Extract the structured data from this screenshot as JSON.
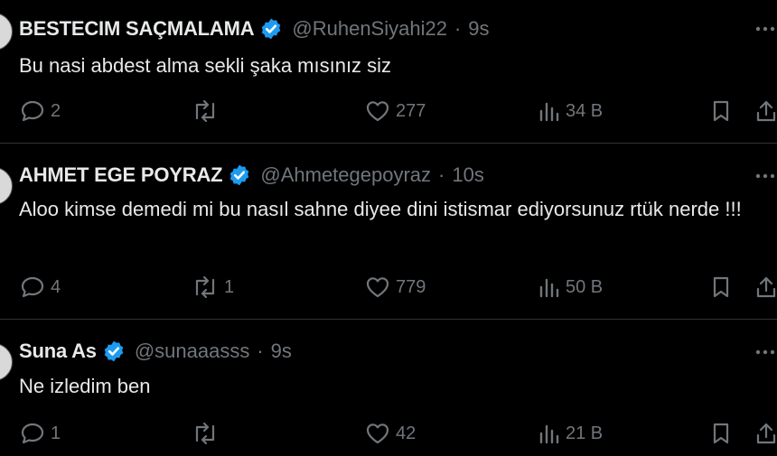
{
  "tweets": [
    {
      "name": "BESTECIM SAÇMALAMA",
      "handle": "@RuhenSiyahi22",
      "time": "9s",
      "text": "Bu nasi abdest alma sekli  şaka mısınız siz",
      "replies": "2",
      "retweets": "",
      "likes": "277",
      "views": "34 B"
    },
    {
      "name": "AHMET EGE POYRAZ",
      "handle": "@Ahmetegepoyraz",
      "time": "10s",
      "text": "Aloo kimse demedi mi bu nasıl sahne diyee  dini istismar ediyorsunuz rtük nerde !!!",
      "replies": "4",
      "retweets": "1",
      "likes": "779",
      "views": "50 B"
    },
    {
      "name": "Suna As",
      "handle": "@sunaaasss",
      "time": "9s",
      "text": "Ne izledim ben",
      "replies": "1",
      "retweets": "",
      "likes": "42",
      "views": "21 B"
    }
  ],
  "separator": "·",
  "colors": {
    "background": "#000000",
    "text": "#e7e9ea",
    "muted": "#71767b",
    "verified": "#1d9bf0",
    "divider": "#2f3336"
  },
  "icons": [
    "more-icon",
    "verified-icon",
    "reply-icon",
    "retweet-icon",
    "like-icon",
    "views-icon",
    "bookmark-icon",
    "share-icon"
  ]
}
